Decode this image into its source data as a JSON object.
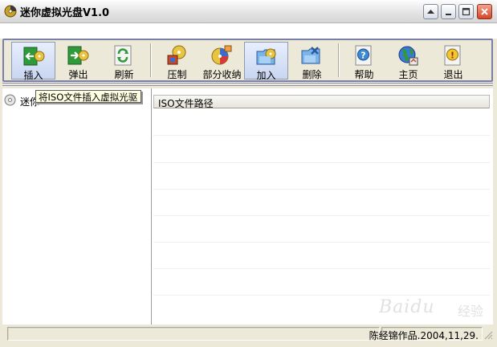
{
  "window": {
    "title": "迷你虚拟光盘V1.0"
  },
  "toolbar": {
    "buttons": [
      {
        "label": "插入",
        "icon": "insert-icon"
      },
      {
        "label": "弹出",
        "icon": "eject-icon"
      },
      {
        "label": "刷新",
        "icon": "refresh-icon"
      },
      {
        "label": "压制",
        "icon": "compress-icon"
      },
      {
        "label": "部分收纳",
        "icon": "partial-store-icon"
      },
      {
        "label": "加入",
        "icon": "add-folder-icon"
      },
      {
        "label": "删除",
        "icon": "delete-folder-icon"
      },
      {
        "label": "帮助",
        "icon": "help-icon"
      },
      {
        "label": "主页",
        "icon": "homepage-icon"
      },
      {
        "label": "退出",
        "icon": "exit-icon"
      }
    ],
    "tooltip": "将ISO文件插入虚拟光驱"
  },
  "tree": {
    "root_label": "迷你"
  },
  "list": {
    "column_header": "ISO文件路径"
  },
  "status": {
    "author_text": "陈经锦作品.2004,11,29."
  },
  "watermark": {
    "text": "Baidu",
    "cn": "经验"
  },
  "colors": {
    "window_bg": "#ece9d8",
    "toolbar_border": "#7a7fa6",
    "tooltip_bg": "#ffffe1",
    "close_red": "#d4462a"
  }
}
